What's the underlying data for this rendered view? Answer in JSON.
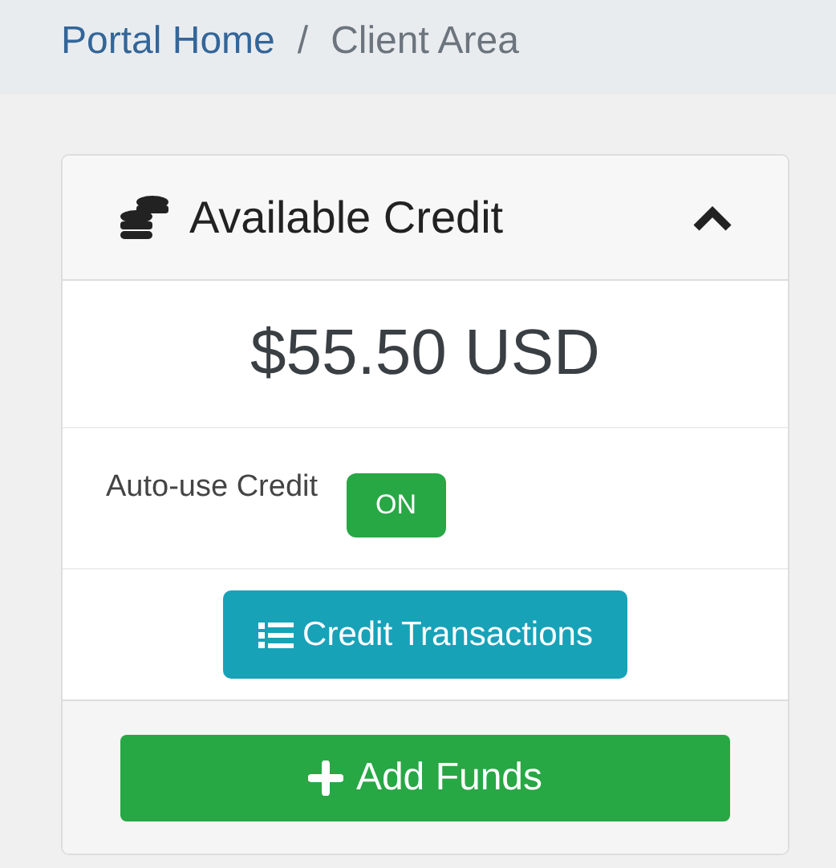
{
  "breadcrumb": [
    {
      "label": "Portal Home",
      "kind": "link"
    },
    {
      "label": "/",
      "kind": "separator"
    },
    {
      "label": "Client Area",
      "kind": "current"
    }
  ],
  "panel": {
    "title": "Available Credit",
    "expanded": true,
    "amount": "$55.50 USD",
    "auto_use": {
      "label": "Auto-use Credit",
      "toggle": "ON",
      "on": true
    },
    "transactions_button": "Credit Transactions",
    "add_funds_button": "Add Funds"
  }
}
